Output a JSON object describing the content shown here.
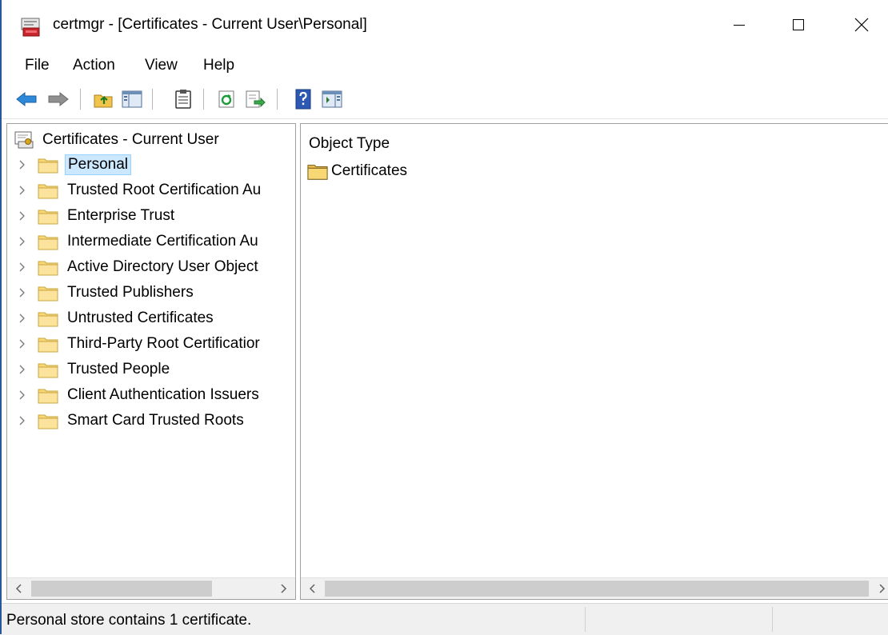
{
  "window": {
    "title": "certmgr - [Certificates - Current User\\Personal]",
    "icon": "certificate-manager-icon",
    "accent": "#2b579a"
  },
  "menu": {
    "items": [
      {
        "label": "File"
      },
      {
        "label": "Action"
      },
      {
        "label": "View"
      },
      {
        "label": "Help"
      }
    ]
  },
  "toolbar": {
    "buttons": [
      "back-arrow-icon",
      "forward-arrow-icon",
      "up-one-level-icon",
      "show-hide-console-tree-icon",
      "properties-icon",
      "refresh-icon",
      "export-list-icon",
      "help-icon",
      "show-hide-action-pane-icon"
    ]
  },
  "tree": {
    "root": "Certificates - Current User",
    "items": [
      {
        "label": "Personal",
        "selected": true
      },
      {
        "label": "Trusted Root Certification Au"
      },
      {
        "label": "Enterprise Trust"
      },
      {
        "label": "Intermediate Certification Au"
      },
      {
        "label": "Active Directory User Object"
      },
      {
        "label": "Trusted Publishers"
      },
      {
        "label": "Untrusted Certificates"
      },
      {
        "label": "Third-Party Root Certificatior"
      },
      {
        "label": "Trusted People"
      },
      {
        "label": "Client Authentication Issuers"
      },
      {
        "label": "Smart Card Trusted Roots"
      }
    ]
  },
  "content": {
    "column_header": "Object Type",
    "items": [
      {
        "label": "Certificates"
      }
    ]
  },
  "status": {
    "text": "Personal store contains 1 certificate."
  },
  "colors": {
    "selection_bg": "#cce8ff",
    "selection_border": "#99d1ff",
    "folder_fill": "#f8d775"
  }
}
